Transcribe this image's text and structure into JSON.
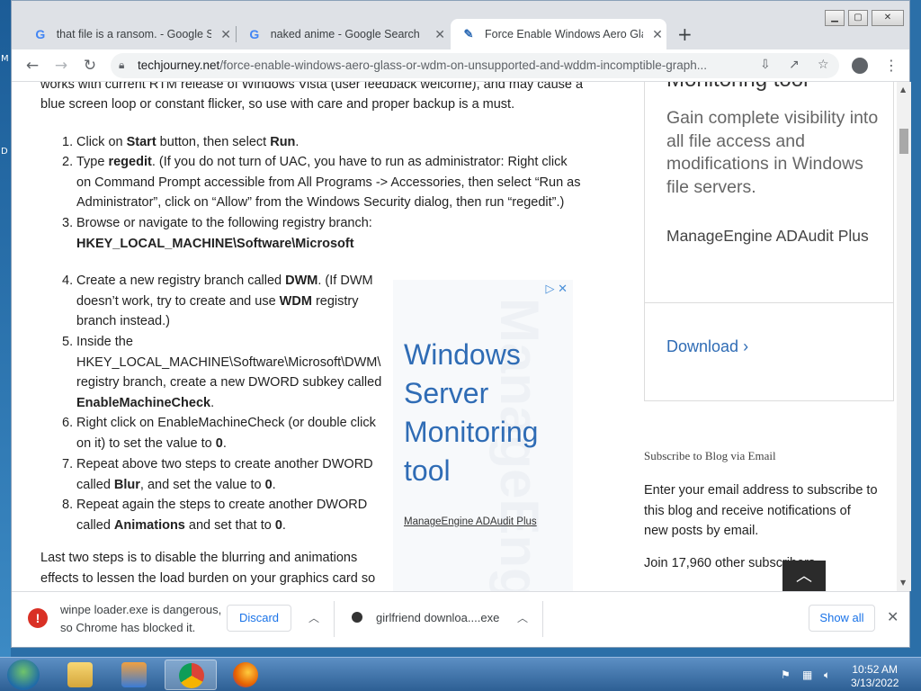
{
  "desktop": {
    "edge_labels": [
      "M",
      "D"
    ]
  },
  "browser": {
    "tabs": [
      {
        "title": "that file is a ransom. - Google Se",
        "icon": "google-icon"
      },
      {
        "title": "naked anime - Google Search",
        "icon": "google-icon"
      },
      {
        "title": "Force Enable Windows Aero Glass",
        "icon": "site-favicon"
      }
    ],
    "new_tab_label": "+",
    "url_domain": "techjourney.net",
    "url_path": "/force-enable-windows-aero-glass-or-wdm-on-unsupported-and-wddm-incomptible-graph..."
  },
  "article": {
    "intro_line1": "works with current RTM release of Windows Vista (user feedback welcome), and may cause a",
    "intro_line2": "blue screen loop or constant flicker, so use with care and proper backup is a must.",
    "steps": [
      {
        "num": "1.",
        "lines": [
          [
            "Click on ",
            "Start",
            " button, then select ",
            "Run",
            "."
          ]
        ]
      },
      {
        "num": "2.",
        "lines": [
          [
            "Type ",
            "regedit",
            ". (If you do not turn of UAC, you have to run as administrator: Right click"
          ],
          [
            "on Command Prompt accessible from All Programs -> Accessories, then select “Run as"
          ],
          [
            "Administrator”, click on “Allow” from the Windows Security dialog, then run “regedit”.)"
          ]
        ]
      },
      {
        "num": "3.",
        "lines": [
          [
            "Browse or navigate to the following registry branch:"
          ],
          [
            "",
            "HKEY_LOCAL_MACHINE\\Software\\Microsoft"
          ]
        ]
      },
      {
        "num": "4.",
        "lines": [
          [
            "Create a new registry branch called ",
            "DWM",
            ". (If DWM"
          ],
          [
            "doesn’t work, try to create and use ",
            "WDM",
            " registry"
          ],
          [
            "branch instead.)"
          ]
        ]
      },
      {
        "num": "5.",
        "lines": [
          [
            "Inside the"
          ],
          [
            "HKEY_LOCAL_MACHINE\\Software\\Microsoft\\DWM\\"
          ],
          [
            "registry branch, create a new DWORD subkey called"
          ],
          [
            "",
            "EnableMachineCheck",
            "."
          ]
        ]
      },
      {
        "num": "6.",
        "lines": [
          [
            "Right click on EnableMachineCheck (or double click"
          ],
          [
            "on it) to set the value to ",
            "0",
            "."
          ]
        ]
      },
      {
        "num": "7.",
        "lines": [
          [
            "Repeat above two steps to create another DWORD"
          ],
          [
            "called ",
            "Blur",
            ", and set the value to ",
            "0",
            "."
          ]
        ]
      },
      {
        "num": "8.",
        "lines": [
          [
            "Repeat again the steps to create another DWORD"
          ],
          [
            "called ",
            "Animations",
            " and set that to ",
            "0",
            "."
          ]
        ]
      }
    ],
    "outro_line1": "Last two steps is to disable the blurring and animations",
    "outro_line2": "effects to lessen the load burden on your graphics card so"
  },
  "ad": {
    "headline": "Windows Server Monitoring tool",
    "sponsor": "ManageEngine ADAudit Plus",
    "watermark": "ManageEngine"
  },
  "sidebar": {
    "card_title": "Monitoring tool",
    "card_desc": "Gain complete visibility into all file access and modifications in Windows file servers.",
    "card_brand": "ManageEngine ADAudit Plus",
    "card_download": "Download",
    "subscribe_heading": "Subscribe to Blog via Email",
    "subscribe_text": "Enter your email address to subscribe to this blog and receive notifications of new posts by email.",
    "join_text": "Join 17,960 other subscribers"
  },
  "downloads": {
    "warn_line1": "winpe loader.exe is dangerous,",
    "warn_line2": "so Chrome has blocked it.",
    "discard_label": "Discard",
    "file2_name": "girlfriend downloa....exe",
    "show_all_label": "Show all"
  },
  "taskbar": {
    "time": "10:52 AM",
    "date": "3/13/2022"
  }
}
